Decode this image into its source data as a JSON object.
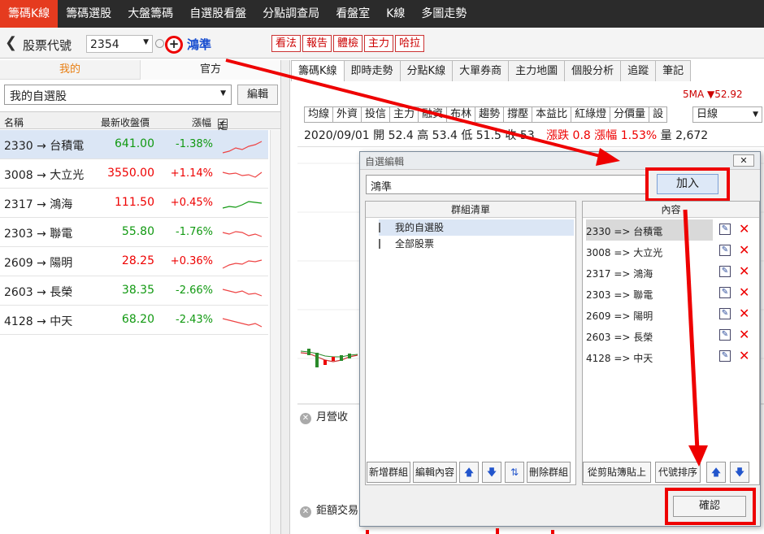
{
  "topnav": [
    "籌碼K線",
    "籌碼選股",
    "大盤籌碼",
    "自選股看盤",
    "分點調查局",
    "看盤室",
    "K線",
    "多圖走勢"
  ],
  "header": {
    "label": "股票代號",
    "code": "2354",
    "name": "鴻準",
    "buttons": [
      "看法",
      "報告",
      "體檢",
      "主力",
      "哈拉"
    ]
  },
  "left": {
    "tabs": [
      "我的",
      "官方"
    ],
    "group": "我的自選股",
    "edit": "編輯",
    "columns": [
      "名稱",
      "最新收盤價",
      "漲幅",
      "走勢圖"
    ],
    "rows": [
      {
        "name": "2330 → 台積電",
        "price": "641.00",
        "change": "-1.38%"
      },
      {
        "name": "3008 → 大立光",
        "price": "3550.00",
        "change": "+1.14%"
      },
      {
        "name": "2317 → 鴻海",
        "price": "111.50",
        "change": "+0.45%"
      },
      {
        "name": "2303 → 聯電",
        "price": "55.80",
        "change": "-1.76%"
      },
      {
        "name": "2609 → 陽明",
        "price": "28.25",
        "change": "+0.36%"
      },
      {
        "name": "2603 → 長榮",
        "price": "38.35",
        "change": "-2.66%"
      },
      {
        "name": "4128 → 中天",
        "price": "68.20",
        "change": "-2.43%"
      }
    ]
  },
  "right": {
    "tabs": [
      "籌碼K線",
      "即時走勢",
      "分點K線",
      "大單券商",
      "主力地圖",
      "個股分析",
      "追蹤",
      "筆記"
    ],
    "ma": "5MA ▼52.92",
    "toolbar": [
      "均線",
      "外資",
      "投信",
      "主力",
      "融資",
      "布林",
      "趨勢",
      "撐壓",
      "本益比",
      "紅綠燈",
      "分價量",
      "設"
    ],
    "period": "日線",
    "quote": {
      "date": "2020/09/01",
      "open": "開 52.4",
      "high": "高 53.4",
      "low": "低 51.5",
      "close": "收 53",
      "chg": "漲跌 0.8",
      "pct": "漲幅 1.53%",
      "vol": "量 2,672"
    },
    "panel2": "月營收",
    "panel3": "鉅額交易"
  },
  "dialog": {
    "title": "自選編輯",
    "input": "鴻準",
    "add": "加入",
    "group_header": "群組清單",
    "groups": [
      "我的自選股",
      "全部股票"
    ],
    "content_header": "內容",
    "items": [
      "2330 => 台積電",
      "3008 => 大立光",
      "2317 => 鴻海",
      "2303 => 聯電",
      "2609 => 陽明",
      "2603 => 長榮",
      "4128 => 中天"
    ],
    "group_buttons": [
      "新增群組",
      "編輯內容",
      "刪除群組"
    ],
    "content_buttons": [
      "從剪貼簿貼上",
      "代號排序"
    ],
    "confirm": "確認"
  },
  "colors": {
    "accent": "#e53b1f",
    "up": "#e00000",
    "down": "#119911",
    "highlight": "#ff0000"
  }
}
